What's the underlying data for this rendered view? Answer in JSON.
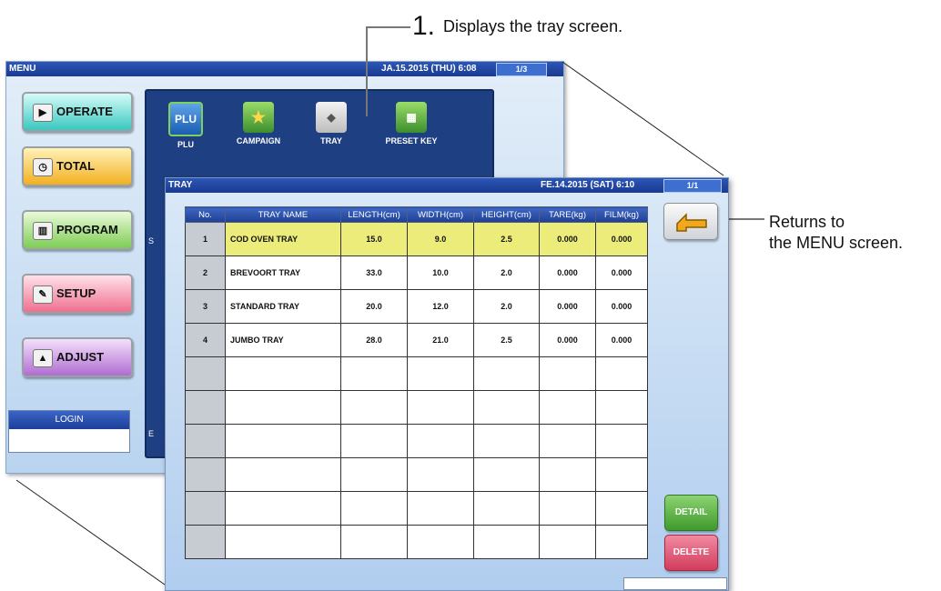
{
  "callouts": {
    "step_number": "1.",
    "step_text": "Displays the tray screen.",
    "return_line1": "Returns to",
    "return_line2": "the MENU screen."
  },
  "menu_screen": {
    "title": "MENU",
    "datetime": "JA.15.2015 (THU)  6:08",
    "page": "1/3",
    "buttons": [
      {
        "label": "OPERATE",
        "icon": "play-icon"
      },
      {
        "label": "TOTAL",
        "icon": "clock-icon"
      },
      {
        "label": "PROGRAM",
        "icon": "book-icon"
      },
      {
        "label": "SETUP",
        "icon": "wrench-icon"
      },
      {
        "label": "ADJUST",
        "icon": "weight-icon"
      }
    ],
    "login_label": "LOGIN",
    "panel_items": [
      {
        "label": "PLU",
        "icon": "plu-icon"
      },
      {
        "label": "CAMPAIGN",
        "icon": "star-icon"
      },
      {
        "label": "TRAY",
        "icon": "tray-icon"
      },
      {
        "label": "PRESET KEY",
        "icon": "preset-key-icon"
      }
    ],
    "panel_side_letters": [
      "S",
      "E"
    ]
  },
  "tray_screen": {
    "title": "TRAY",
    "datetime": "FE.14.2015 (SAT)  6:10",
    "page": "1/1",
    "columns": [
      "No.",
      "TRAY NAME",
      "LENGTH(cm)",
      "WIDTH(cm)",
      "HEIGHT(cm)",
      "TARE(kg)",
      "FILM(kg)"
    ],
    "rows": [
      {
        "no": "1",
        "name": "COD OVEN TRAY",
        "length": "15.0",
        "width": "9.0",
        "height": "2.5",
        "tare": "0.000",
        "film": "0.000",
        "selected": true
      },
      {
        "no": "2",
        "name": "BREVOORT TRAY",
        "length": "33.0",
        "width": "10.0",
        "height": "2.0",
        "tare": "0.000",
        "film": "0.000"
      },
      {
        "no": "3",
        "name": "STANDARD TRAY",
        "length": "20.0",
        "width": "12.0",
        "height": "2.0",
        "tare": "0.000",
        "film": "0.000"
      },
      {
        "no": "4",
        "name": "JUMBO TRAY",
        "length": "28.0",
        "width": "21.0",
        "height": "2.5",
        "tare": "0.000",
        "film": "0.000"
      },
      {
        "no": "",
        "name": "",
        "length": "",
        "width": "",
        "height": "",
        "tare": "",
        "film": ""
      },
      {
        "no": "",
        "name": "",
        "length": "",
        "width": "",
        "height": "",
        "tare": "",
        "film": ""
      },
      {
        "no": "",
        "name": "",
        "length": "",
        "width": "",
        "height": "",
        "tare": "",
        "film": ""
      },
      {
        "no": "",
        "name": "",
        "length": "",
        "width": "",
        "height": "",
        "tare": "",
        "film": ""
      },
      {
        "no": "",
        "name": "",
        "length": "",
        "width": "",
        "height": "",
        "tare": "",
        "film": ""
      },
      {
        "no": "",
        "name": "",
        "length": "",
        "width": "",
        "height": "",
        "tare": "",
        "film": ""
      }
    ],
    "return_icon": "return-arrow-icon",
    "detail_label": "DETAIL",
    "delete_label": "DELETE"
  },
  "colors": {
    "title_bar": "#1a3a8f",
    "selected_row": "#ecec7a",
    "return_arrow": "#f2a81a"
  }
}
